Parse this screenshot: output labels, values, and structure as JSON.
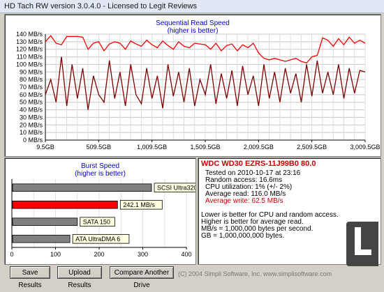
{
  "window": {
    "title": "HD Tach RW version 3.0.4.0 - Licensed to Legit Reviews"
  },
  "read_chart": {
    "title": "Sequential Read Speed",
    "subtitle": "(higher is better)"
  },
  "burst_chart": {
    "title": "Burst Speed",
    "subtitle": "(higher is better)"
  },
  "info": {
    "drive_name": "WDC WD30 EZRS-11J99B0 80.0",
    "tested_on": "Tested on 2010-10-17 at 23:16",
    "random_access": "Random access: 16.6ms",
    "cpu": "CPU utilization: 1% (+/- 2%)",
    "avg_read": "Average read: 116.0 MB/s",
    "avg_write": "Average write: 62.5 MB/s",
    "note1": "Lower is better for CPU and random access.",
    "note2": "Higher is better for average read.",
    "note3": "MB/s = 1,000,000 bytes per second.",
    "note4": "GB = 1,000,000,000 bytes."
  },
  "buttons": {
    "save": "Save Results",
    "upload": "Upload Results",
    "compare": "Compare Another Drive"
  },
  "copyright": "(C) 2004 Simpli Software, Inc. www.simplisoftware.com",
  "colors": {
    "read_line": "#ff0000",
    "write_line": "#800000",
    "accent_bar": "#ff0000",
    "gray_bar": "#808080"
  },
  "chart_data": [
    {
      "type": "line",
      "title": "Sequential Read Speed",
      "subtitle": "(higher is better)",
      "y_ticks": [
        "140 MB/s",
        "130 MB/s",
        "120 MB/s",
        "110 MB/s",
        "100 MB/s",
        "90 MB/s",
        "80 MB/s",
        "70 MB/s",
        "60 MB/s",
        "50 MB/s",
        "40 MB/s",
        "30 MB/s",
        "20 MB/s",
        "10 MB/s",
        "0 MB/s"
      ],
      "ylim": [
        0,
        140
      ],
      "x_ticks": [
        "9.5GB",
        "509.5GB",
        "1,009.5GB",
        "1,509.5GB",
        "2,009.5GB",
        "2,509.5GB",
        "3,009.5GB"
      ],
      "xlim": [
        9.5,
        3009.5
      ],
      "grid": true,
      "series": [
        {
          "color": "#ff0000",
          "x": [
            9.5,
            60,
            110,
            160,
            210,
            260,
            310,
            360,
            410,
            460,
            510,
            560,
            610,
            660,
            710,
            760,
            810,
            860,
            910,
            960,
            1010,
            1060,
            1110,
            1160,
            1210,
            1260,
            1310,
            1360,
            1410,
            1460,
            1510,
            1560,
            1610,
            1660,
            1710,
            1760,
            1810,
            1860,
            1910,
            1960,
            2010,
            2060,
            2110,
            2160,
            2210,
            2260,
            2310,
            2360,
            2410,
            2460,
            2510,
            2560,
            2610,
            2660,
            2710,
            2760,
            2810,
            2860,
            2910,
            2960,
            3009.5
          ],
          "values": [
            130,
            138,
            128,
            126,
            137,
            137,
            137,
            136,
            120,
            128,
            130,
            118,
            127,
            130,
            128,
            120,
            131,
            127,
            124,
            132,
            126,
            122,
            131,
            125,
            120,
            130,
            124,
            122,
            128,
            127,
            126,
            120,
            128,
            118,
            125,
            127,
            118,
            126,
            122,
            128,
            115,
            108,
            106,
            108,
            106,
            104,
            106,
            108,
            104,
            102,
            110,
            112,
            135,
            132,
            124,
            134,
            126,
            136,
            128,
            132,
            128
          ]
        },
        {
          "color": "#800000",
          "x": [
            9.5,
            60,
            110,
            160,
            210,
            260,
            310,
            360,
            410,
            460,
            510,
            560,
            610,
            660,
            710,
            760,
            810,
            860,
            910,
            960,
            1010,
            1060,
            1110,
            1160,
            1210,
            1260,
            1310,
            1360,
            1410,
            1460,
            1510,
            1560,
            1610,
            1660,
            1710,
            1760,
            1810,
            1860,
            1910,
            1960,
            2010,
            2060,
            2110,
            2160,
            2210,
            2260,
            2310,
            2360,
            2410,
            2460,
            2510,
            2560,
            2610,
            2660,
            2710,
            2760,
            2810,
            2860,
            2910,
            2960,
            3009.5
          ],
          "values": [
            60,
            80,
            50,
            110,
            45,
            100,
            55,
            95,
            40,
            85,
            60,
            50,
            105,
            55,
            90,
            45,
            100,
            60,
            48,
            95,
            55,
            85,
            42,
            100,
            58,
            90,
            50,
            95,
            45,
            80,
            60,
            100,
            48,
            88,
            55,
            92,
            45,
            98,
            60,
            85,
            45,
            100,
            55,
            90,
            50,
            95,
            62,
            88,
            50,
            100,
            58,
            105,
            62,
            90,
            60,
            100,
            55,
            95,
            62,
            92,
            90
          ]
        }
      ]
    },
    {
      "type": "bar",
      "title": "Burst Speed",
      "subtitle": "(higher is better)",
      "categories": [
        "SCSI Ultra320",
        "242.1 MB/s",
        "SATA 150",
        "ATA UltraDMA 6"
      ],
      "values": [
        320,
        242.1,
        150,
        133
      ],
      "x_ticks": [
        "0",
        "100",
        "200",
        "300",
        "400"
      ],
      "xlim": [
        0,
        400
      ],
      "grid": true,
      "highlight_index": 1
    }
  ]
}
